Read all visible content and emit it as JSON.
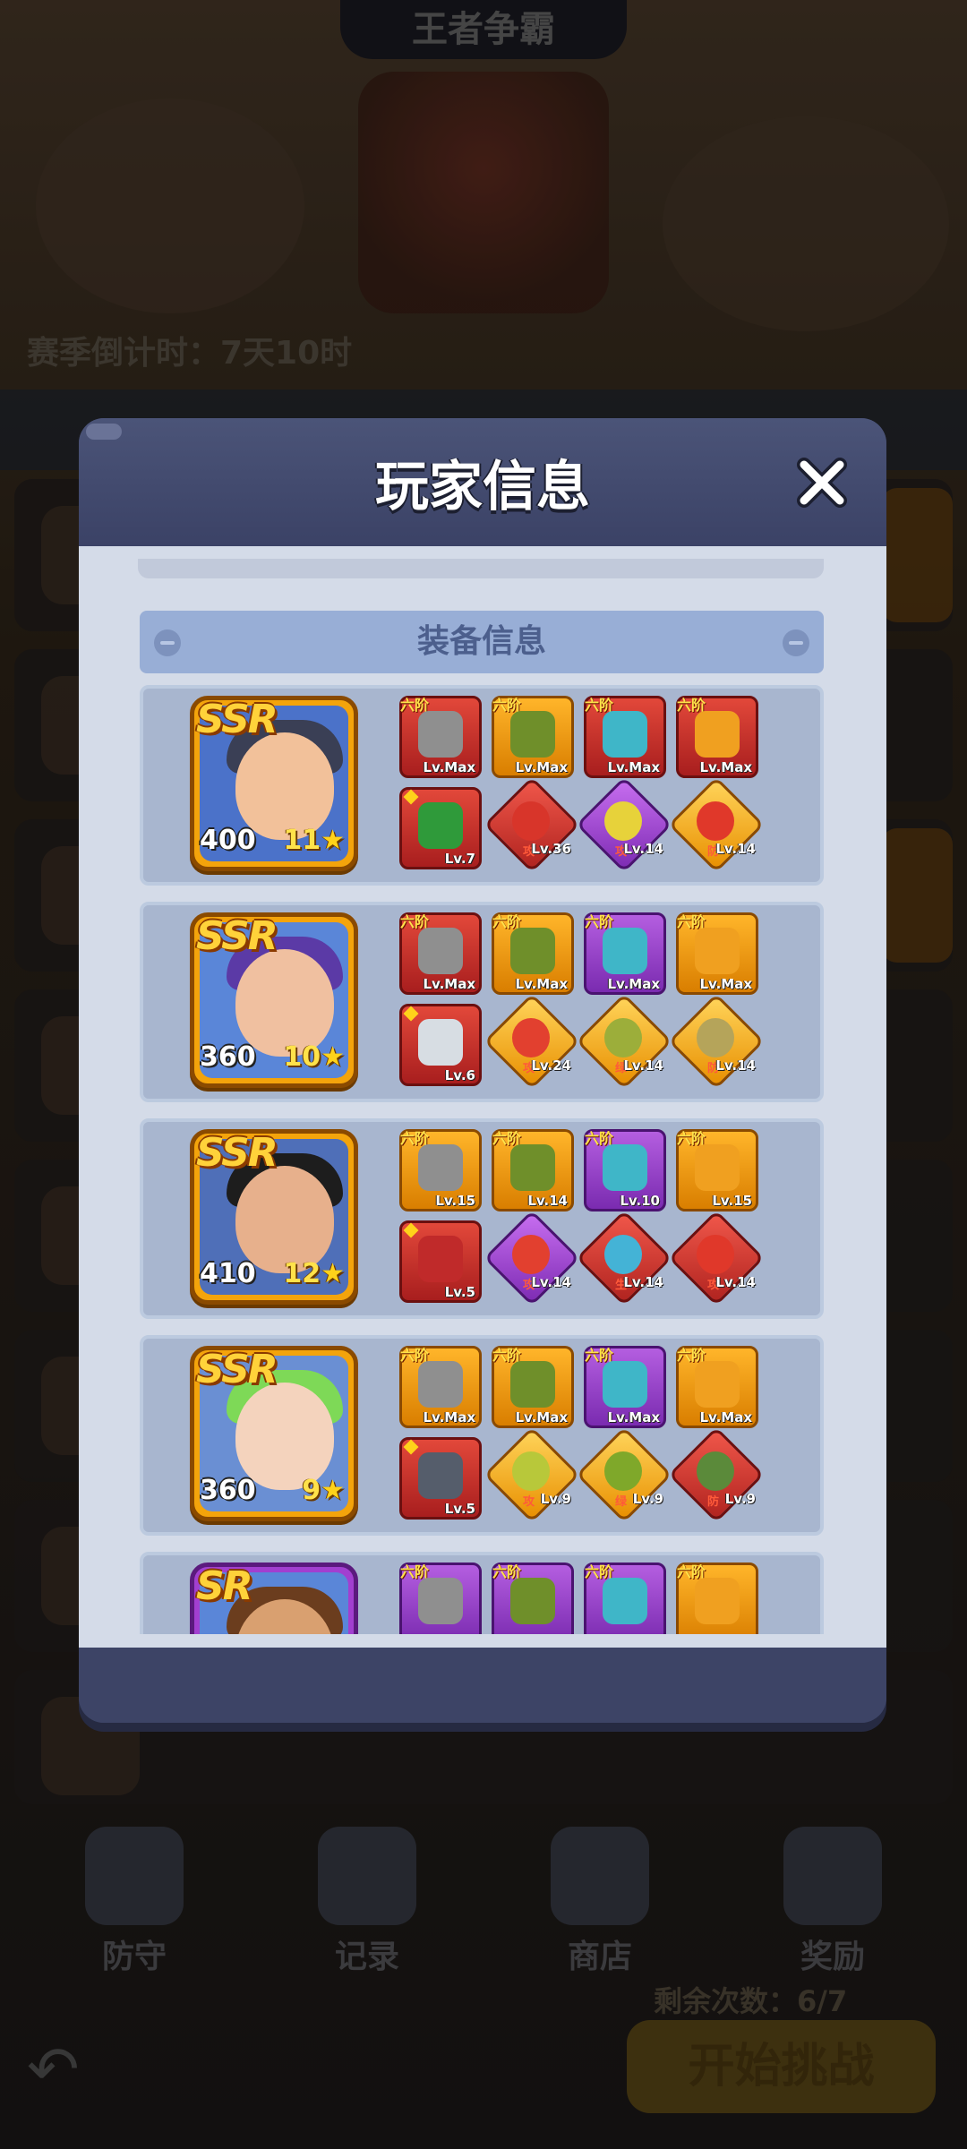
{
  "background": {
    "title": "王者争霸",
    "season_countdown": "赛季倒计时：7天10时",
    "nav": [
      "防守",
      "记录",
      "商店",
      "奖励"
    ],
    "remaining": "剩余次数：6/7",
    "start_button": "开始挑战"
  },
  "modal": {
    "title": "玩家信息",
    "section_title": "装备信息"
  },
  "heroes": [
    {
      "rarity": "SSR",
      "power": "400",
      "stars": "11",
      "equipment": [
        {
          "tier": "六阶",
          "level": "Lv.Max",
          "color": "red",
          "icon": "chainsaw-icon"
        },
        {
          "tier": "六阶",
          "level": "Lv.Max",
          "color": "gold",
          "icon": "armor-vest-icon"
        },
        {
          "tier": "六阶",
          "level": "Lv.Max",
          "color": "red",
          "icon": "glove-icon"
        },
        {
          "tier": "六阶",
          "level": "Lv.Max",
          "color": "red",
          "icon": "mask-icon"
        }
      ],
      "items": [
        {
          "kind": "square",
          "level": "Lv.7",
          "color": "red",
          "icon": "billiard-ball-icon"
        },
        {
          "kind": "gem",
          "tag": "攻",
          "level": "Lv.36",
          "color": "red",
          "icon": "cherry-bomb-icon"
        },
        {
          "kind": "gem",
          "tag": "攻",
          "level": "Lv.14",
          "color": "purple",
          "icon": "lemon-icon"
        },
        {
          "kind": "gem",
          "tag": "防",
          "level": "Lv.14",
          "color": "gold",
          "icon": "strawberry-icon"
        }
      ]
    },
    {
      "rarity": "SSR",
      "power": "360",
      "stars": "10",
      "equipment": [
        {
          "tier": "六阶",
          "level": "Lv.Max",
          "color": "red",
          "icon": "chainsaw-icon"
        },
        {
          "tier": "六阶",
          "level": "Lv.Max",
          "color": "gold",
          "icon": "armor-vest-icon"
        },
        {
          "tier": "六阶",
          "level": "Lv.Max",
          "color": "purple",
          "icon": "glove-icon"
        },
        {
          "tier": "六阶",
          "level": "Lv.Max",
          "color": "gold",
          "icon": "mask-icon"
        }
      ],
      "items": [
        {
          "kind": "square",
          "level": "Lv.6",
          "color": "red",
          "icon": "knife-icon"
        },
        {
          "kind": "gem",
          "tag": "攻",
          "level": "Lv.24",
          "color": "gold",
          "icon": "tomato-icon"
        },
        {
          "kind": "gem",
          "tag": "绿",
          "level": "Lv.14",
          "color": "gold",
          "icon": "durian-icon"
        },
        {
          "kind": "gem",
          "tag": "防",
          "level": "Lv.14",
          "color": "gold",
          "icon": "potato-icon"
        }
      ]
    },
    {
      "rarity": "SSR",
      "power": "410",
      "stars": "12",
      "equipment": [
        {
          "tier": "六阶",
          "level": "Lv.15",
          "color": "gold",
          "icon": "chainsaw-icon"
        },
        {
          "tier": "六阶",
          "level": "Lv.14",
          "color": "gold",
          "icon": "armor-vest-icon"
        },
        {
          "tier": "六阶",
          "level": "Lv.10",
          "color": "purple",
          "icon": "glove-icon"
        },
        {
          "tier": "六阶",
          "level": "Lv.15",
          "color": "gold",
          "icon": "mask-icon"
        }
      ],
      "items": [
        {
          "kind": "square",
          "level": "Lv.5",
          "color": "red",
          "icon": "grenade-icon"
        },
        {
          "kind": "gem",
          "tag": "攻",
          "level": "Lv.14",
          "color": "purple",
          "icon": "tomato-icon"
        },
        {
          "kind": "gem",
          "tag": "生",
          "level": "Lv.14",
          "color": "red",
          "icon": "goggles-icon"
        },
        {
          "kind": "gem",
          "tag": "攻",
          "level": "Lv.14",
          "color": "red",
          "icon": "strawberry-icon"
        }
      ]
    },
    {
      "rarity": "SSR",
      "power": "360",
      "stars": "9",
      "equipment": [
        {
          "tier": "六阶",
          "level": "Lv.Max",
          "color": "gold",
          "icon": "chainsaw-icon"
        },
        {
          "tier": "六阶",
          "level": "Lv.Max",
          "color": "gold",
          "icon": "armor-vest-icon"
        },
        {
          "tier": "六阶",
          "level": "Lv.Max",
          "color": "purple",
          "icon": "glove-icon"
        },
        {
          "tier": "六阶",
          "level": "Lv.Max",
          "color": "gold",
          "icon": "mask-icon"
        }
      ],
      "items": [
        {
          "kind": "square",
          "level": "Lv.5",
          "color": "red",
          "icon": "rifle-icon"
        },
        {
          "kind": "gem",
          "tag": "攻",
          "level": "Lv.9",
          "color": "gold",
          "icon": "corn-icon"
        },
        {
          "kind": "gem",
          "tag": "绿",
          "level": "Lv.9",
          "color": "gold",
          "icon": "pepper-icon"
        },
        {
          "kind": "gem",
          "tag": "防",
          "level": "Lv.9",
          "color": "red",
          "icon": "zombie-icon"
        }
      ]
    },
    {
      "rarity": "SR",
      "power": "",
      "stars": "",
      "equipment": [
        {
          "tier": "六阶",
          "level": "",
          "color": "purple",
          "icon": "chainsaw-icon"
        },
        {
          "tier": "六阶",
          "level": "",
          "color": "purple",
          "icon": "armor-vest-icon"
        },
        {
          "tier": "六阶",
          "level": "",
          "color": "purple",
          "icon": "glove-icon"
        },
        {
          "tier": "六阶",
          "level": "",
          "color": "gold",
          "icon": "mask-icon"
        }
      ],
      "items": []
    }
  ]
}
